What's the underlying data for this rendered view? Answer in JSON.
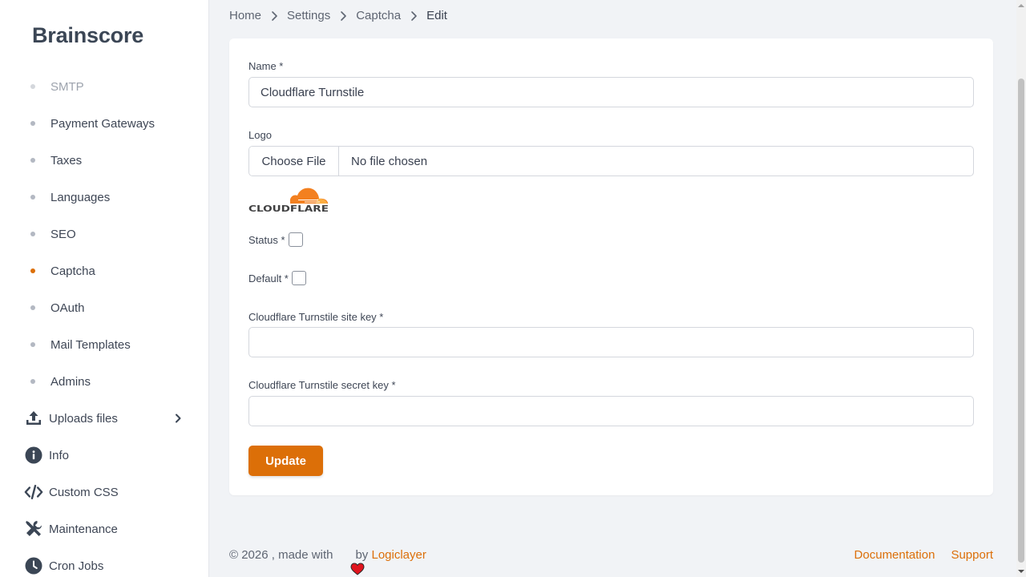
{
  "sidebar": {
    "brand": "Brainscore",
    "sub_items": [
      {
        "label": "SMTP"
      },
      {
        "label": "Payment Gateways"
      },
      {
        "label": "Taxes"
      },
      {
        "label": "Languages"
      },
      {
        "label": "SEO"
      },
      {
        "label": "Captcha",
        "active": true
      },
      {
        "label": "OAuth"
      },
      {
        "label": "Mail Templates"
      },
      {
        "label": "Admins"
      }
    ],
    "main_items": [
      {
        "label": "Uploads files",
        "icon": "upload-icon",
        "has_submenu": true
      },
      {
        "label": "Info",
        "icon": "info-icon"
      },
      {
        "label": "Custom CSS",
        "icon": "code-icon"
      },
      {
        "label": "Maintenance",
        "icon": "tools-icon"
      },
      {
        "label": "Cron Jobs",
        "icon": "clock-icon"
      }
    ]
  },
  "breadcrumb": [
    "Home",
    "Settings",
    "Captcha",
    "Edit"
  ],
  "form": {
    "name_label": "Name *",
    "name_value": "Cloudflare Turnstile",
    "logo_label": "Logo",
    "file_button": "Choose File",
    "file_status": "No file chosen",
    "logo_text": "CLOUDFLARE",
    "status_label": "Status *",
    "status_checked": false,
    "default_label": "Default *",
    "default_checked": false,
    "site_key_label": "Cloudflare Turnstile site key *",
    "site_key_value": "",
    "secret_key_label": "Cloudflare Turnstile secret key *",
    "secret_key_value": "",
    "submit_label": "Update"
  },
  "footer": {
    "copyright_prefix": "© 2026 , made with",
    "by_text": "by",
    "author": "Logiclayer",
    "links": [
      "Documentation",
      "Support"
    ]
  },
  "colors": {
    "accent": "#dc6f08",
    "heart": "#e0141e"
  }
}
